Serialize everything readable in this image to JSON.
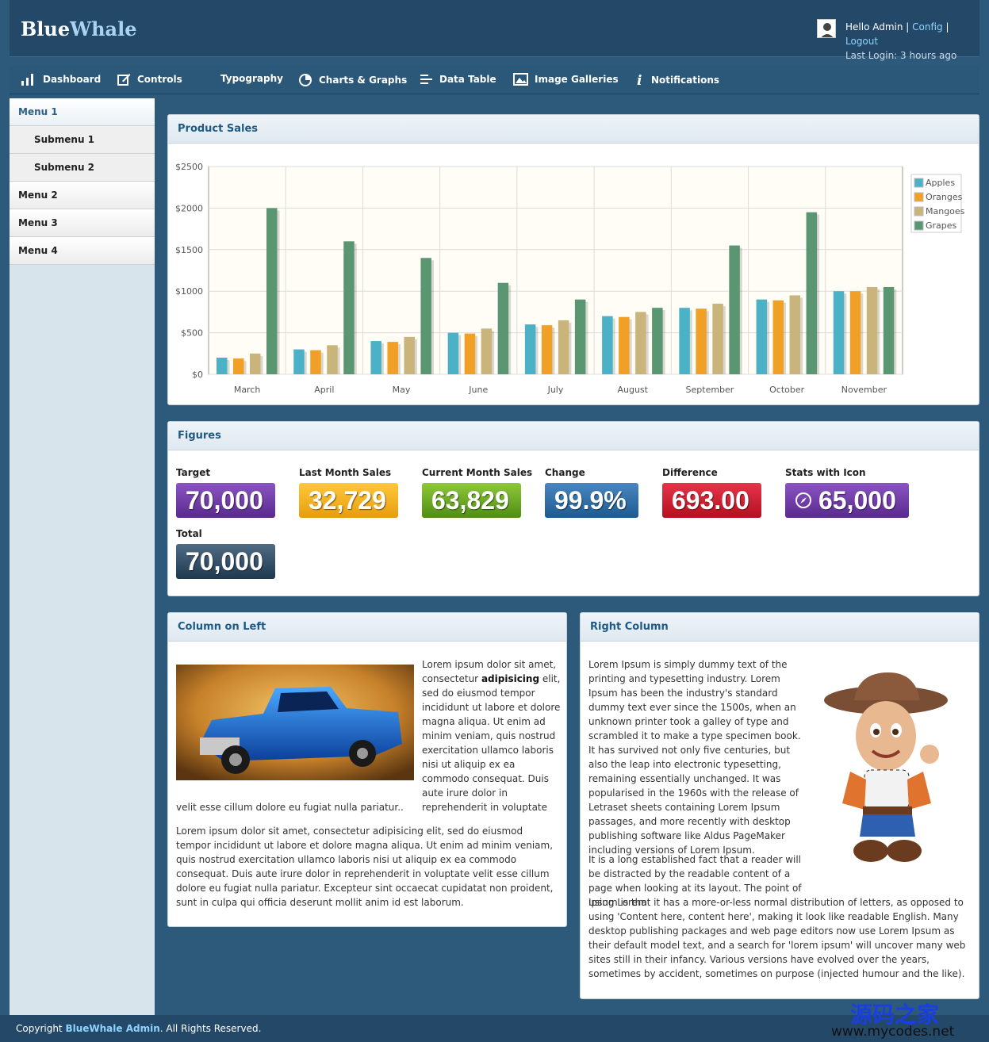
{
  "header": {
    "logo_part1": "Blue",
    "logo_part2": "Whale",
    "greeting": "Hello Admin",
    "config_link": "Config",
    "logout_link": "Logout",
    "last_login": "Last Login: 3 hours ago"
  },
  "nav": [
    {
      "label": "Dashboard",
      "icon": "bar-chart-icon"
    },
    {
      "label": "Controls",
      "icon": "edit-icon"
    },
    {
      "label": "Typography",
      "icon": ""
    },
    {
      "label": "Charts & Graphs",
      "icon": "pie-chart-icon"
    },
    {
      "label": "Data Table",
      "icon": "list-icon"
    },
    {
      "label": "Image Galleries",
      "icon": "image-icon"
    },
    {
      "label": "Notifications",
      "icon": "info-icon"
    }
  ],
  "sidebar": {
    "items": [
      {
        "label": "Menu 1"
      },
      {
        "label": "Submenu 1"
      },
      {
        "label": "Submenu 2"
      },
      {
        "label": "Menu 2"
      },
      {
        "label": "Menu 3"
      },
      {
        "label": "Menu 4"
      }
    ]
  },
  "product_sales": {
    "title": "Product Sales"
  },
  "chart_data": {
    "type": "bar",
    "categories": [
      "March",
      "April",
      "May",
      "June",
      "July",
      "August",
      "September",
      "October",
      "November"
    ],
    "series": [
      {
        "name": "Apples",
        "color": "#4ab1c6",
        "values": [
          200,
          300,
          400,
          500,
          600,
          700,
          800,
          900,
          1000
        ]
      },
      {
        "name": "Oranges",
        "color": "#f0a026",
        "values": [
          190,
          290,
          390,
          490,
          590,
          690,
          790,
          890,
          1000
        ]
      },
      {
        "name": "Mangoes",
        "color": "#c9b47c",
        "values": [
          250,
          350,
          450,
          550,
          650,
          750,
          850,
          950,
          1050
        ]
      },
      {
        "name": "Grapes",
        "color": "#5a9672",
        "values": [
          2000,
          1600,
          1400,
          1100,
          900,
          800,
          1550,
          1950,
          1050
        ]
      }
    ],
    "ylim": [
      0,
      2500
    ],
    "yticks": [
      "$0",
      "$500",
      "$1000",
      "$1500",
      "$2000",
      "$2500"
    ],
    "grid": true,
    "legend": "right"
  },
  "figures": {
    "title": "Figures",
    "items": [
      {
        "label": "Target",
        "value": "70,000",
        "color": "purple"
      },
      {
        "label": "Last Month Sales",
        "value": "32,729",
        "color": "orange"
      },
      {
        "label": "Current Month Sales",
        "value": "63,829",
        "color": "green"
      },
      {
        "label": "Change",
        "value": "99.9%",
        "color": "blue"
      },
      {
        "label": "Difference",
        "value": "693.00",
        "color": "red"
      },
      {
        "label": "Stats with Icon",
        "value": "65,000",
        "color": "purple",
        "icon": "compass-icon"
      },
      {
        "label": "Total",
        "value": "70,000",
        "color": "dark-slate"
      }
    ]
  },
  "left_column": {
    "title": "Column on Left",
    "p1_start": "Lorem ipsum dolor sit amet, consectetur ",
    "p1_bold": "adipisicing",
    "p1_rest": " elit, sed do eiusmod tempor incididunt ut labore et dolore magna aliqua. Ut enim ad minim veniam, quis nostrud exercitation ullamco laboris nisi ut aliquip ex ea commodo consequat. Duis aute irure dolor in reprehenderit in voluptate",
    "p1_tail": "velit esse cillum dolore eu fugiat nulla pariatur..",
    "p2": "Lorem ipsum dolor sit amet, consectetur adipisicing elit, sed do eiusmod tempor incididunt ut labore et dolore magna aliqua. Ut enim ad minim veniam, quis nostrud exercitation ullamco laboris nisi ut aliquip ex ea commodo consequat. Duis aute irure dolor in reprehenderit in voluptate velit esse cillum dolore eu fugiat nulla pariatur. Excepteur sint occaecat cupidatat non proident, sunt in culpa qui officia deserunt mollit anim id est laborum."
  },
  "right_column": {
    "title": "Right Column",
    "p1": "Lorem Ipsum is simply dummy text of the printing and typesetting industry. Lorem Ipsum has been the industry's standard dummy text ever since the 1500s, when an unknown printer took a galley of type and scrambled it to make a type specimen book. It has survived not only five centuries, but also the leap into electronic typesetting, remaining essentially unchanged. It was popularised in the 1960s with the release of Letraset sheets containing Lorem Ipsum passages, and more recently with desktop publishing software like Aldus PageMaker including versions of Lorem Ipsum.",
    "p2_a": "It is a long established fact that a reader will be distracted by the readable content of a page when looking at its layout. The point of using Lorem",
    "p2_b": "Ipsum is that it has a more-or-less normal distribution of letters, as opposed to using 'Content here, content here', making it look like readable English. Many desktop publishing packages and web page editors now use Lorem Ipsum as their default model text, and a search for 'lorem ipsum' will uncover many web sites still in their infancy. Various versions have evolved over the years, sometimes by accident, sometimes on purpose (injected humour and the like)."
  },
  "footer": {
    "prefix": "Copyright ",
    "brand": "BlueWhale Admin",
    "suffix": ". All Rights Reserved."
  },
  "watermark": {
    "cn": "源码之家",
    "url": "www.mycodes.net"
  }
}
